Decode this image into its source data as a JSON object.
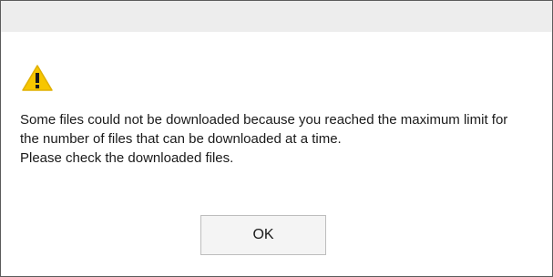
{
  "dialog": {
    "icon": "warning-icon",
    "message_lines": [
      "Some files could not be downloaded because you reached the maximum limit for",
      "the number of files that can be downloaded at a time.",
      "Please check the downloaded files."
    ],
    "ok_label": "OK"
  },
  "colors": {
    "title_bar": "#ededed",
    "warning_fill": "#f7c600",
    "button_bg": "#f4f4f4",
    "button_border": "#bdbdbd",
    "dialog_border": "#5c5c5c"
  }
}
